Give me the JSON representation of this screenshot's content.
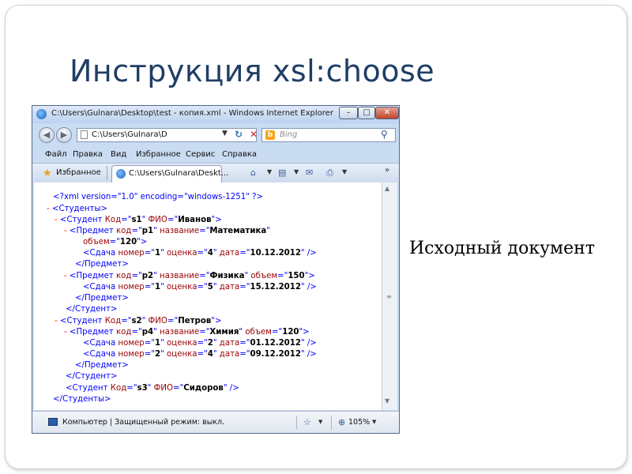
{
  "slide": {
    "title": "Инструкция xsl:choose",
    "caption": "Исходный документ"
  },
  "browser": {
    "window_title": "C:\\Users\\Gulnara\\Desktop\\test - копия.xml - Windows Internet Explorer",
    "address": "C:\\Users\\Gulnara\\D",
    "search_placeholder": "Bing",
    "bing_glyph": "b",
    "menu": [
      "Файл",
      "Правка",
      "Вид",
      "Избранное",
      "Сервис",
      "Справка"
    ],
    "favorites_label": "Избранное",
    "tab_label": "C:\\Users\\Gulnara\\Deskt...",
    "status_text": "Компьютер | Защищенный режим: выкл.",
    "zoom": "105%",
    "icons": [
      "ie-logo-icon",
      "back-icon",
      "forward-icon",
      "refresh-icon",
      "stop-icon",
      "search-icon",
      "star-icon",
      "home-icon",
      "feeds-icon",
      "mail-icon",
      "print-icon",
      "computer-icon",
      "zoom-icon"
    ]
  },
  "xml": {
    "declaration": "<?xml version=\"1.0\" encoding=\"windows-1251\" ?>",
    "root_open": "<Студенты>",
    "s1": {
      "kod": "s1",
      "fio": "Иванов"
    },
    "p1": {
      "kod": "p1",
      "name": "Математика",
      "volume": "120"
    },
    "p1_exam": {
      "num": "1",
      "grade": "4",
      "date": "10.12.2012"
    },
    "p2": {
      "kod": "p2",
      "name": "Физика",
      "volume": "150"
    },
    "p2_exam": {
      "num": "1",
      "grade": "5",
      "date": "15.12.2012"
    },
    "s2": {
      "kod": "s2",
      "fio": "Петров"
    },
    "p4": {
      "kod": "p4",
      "name": "Химия",
      "volume": "120"
    },
    "p4_exam1": {
      "num": "1",
      "grade": "2",
      "date": "01.12.2012"
    },
    "p4_exam2": {
      "num": "2",
      "grade": "4",
      "date": "09.12.2012"
    },
    "s3": {
      "kod": "s3",
      "fio": "Сидоров"
    },
    "subject_close": "</Предмет>",
    "student_close": "</Студент>",
    "root_close": "</Студенты>"
  }
}
